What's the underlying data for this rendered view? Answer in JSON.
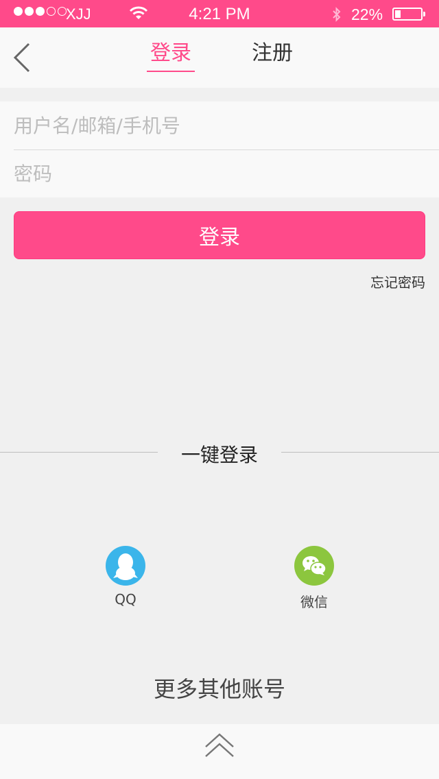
{
  "status_bar": {
    "carrier": "XJJ",
    "time": "4:21 PM",
    "battery_percent": "22%",
    "battery_level": 0.22,
    "signal_bars_filled": 3,
    "signal_bars_total": 5
  },
  "nav": {
    "back_icon": "chevron-left-icon",
    "tab_login": "登录",
    "tab_register": "注册",
    "active_tab": "login"
  },
  "form": {
    "username_placeholder": "用户名/邮箱/手机号",
    "username_value": "",
    "password_placeholder": "密码",
    "password_value": ""
  },
  "actions": {
    "login_label": "登录",
    "forgot_password": "忘记密码"
  },
  "quick_login": {
    "title": "一键登录",
    "providers": [
      {
        "label": "QQ",
        "icon": "qq-icon"
      },
      {
        "label": "微信",
        "icon": "wechat-icon"
      }
    ]
  },
  "more_accounts": "更多其他账号",
  "bottom_icon": "double-chevron-up-icon",
  "colors": {
    "accent": "#ff4a8a",
    "background": "#f0f0f0",
    "panel": "#f9f9f9",
    "qq": "#3bb5ea",
    "wechat": "#8cc63e"
  }
}
